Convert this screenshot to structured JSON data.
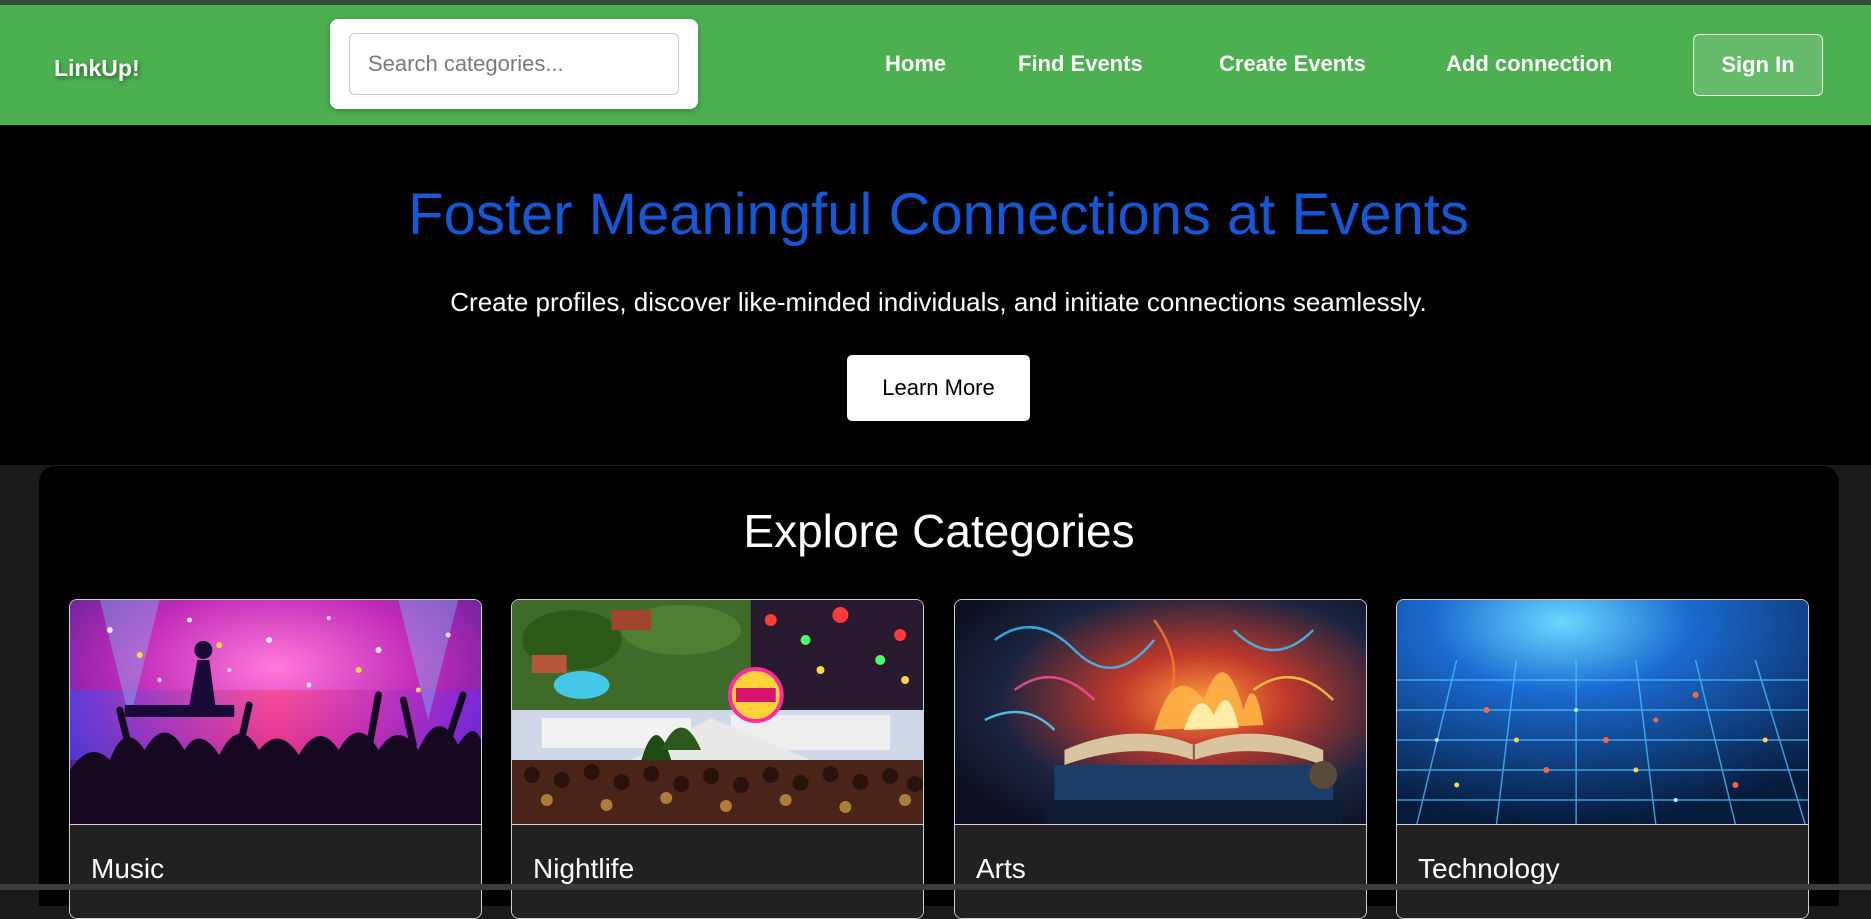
{
  "nav": {
    "logo": "LinkUp!",
    "search_placeholder": "Search categories...",
    "links": [
      "Home",
      "Find Events",
      "Create Events",
      "Add connection"
    ],
    "signin_label": "Sign In"
  },
  "hero": {
    "title": "Foster Meaningful Connections at Events",
    "subtitle": "Create profiles, discover like-minded individuals, and initiate connections seamlessly.",
    "button_label": "Learn More"
  },
  "categories": {
    "heading": "Explore Categories",
    "items": [
      {
        "title": "Music",
        "image": "concert-crowd-image"
      },
      {
        "title": "Nightlife",
        "image": "nightlife-party-image"
      },
      {
        "title": "Arts",
        "image": "arts-book-image"
      },
      {
        "title": "Technology",
        "image": "circuit-technology-image"
      }
    ]
  },
  "colors": {
    "navbar": "#4caf50",
    "hero_title": "#1558d6",
    "background": "#000000"
  }
}
